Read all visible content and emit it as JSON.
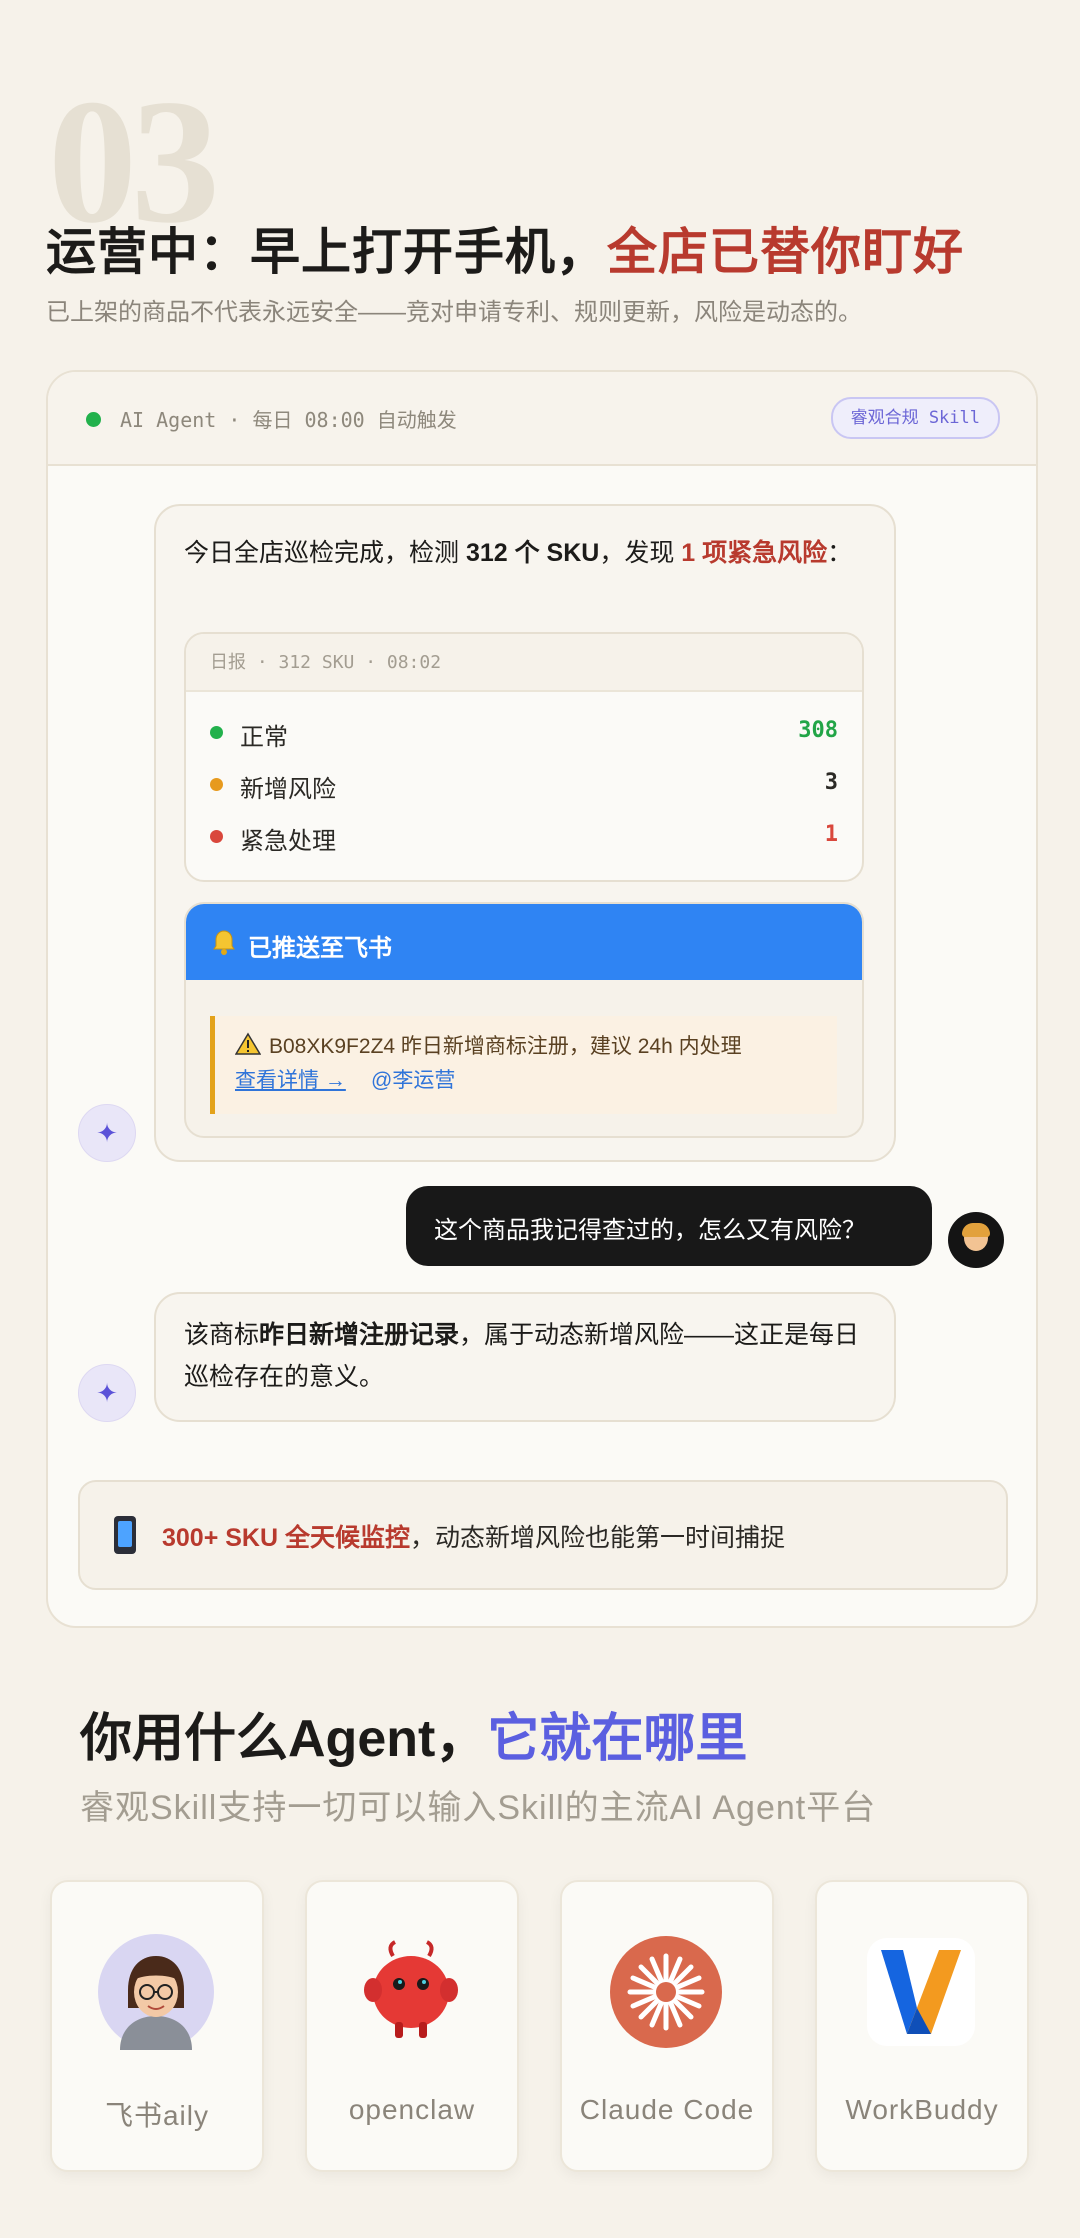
{
  "section_number": "03",
  "section1": {
    "title_part1": "运营中：早上打开手机，",
    "title_part2": "全店已替你盯好",
    "subtitle": "已上架的商品不代表永远安全——竞对申请专利、规则更新，风险是动态的。"
  },
  "chat_card": {
    "header": {
      "status_color": "#22b14c",
      "label": "AI Agent · 每日 08:00 自动触发",
      "skill_badge": "睿观合规 Skill"
    },
    "ai_message_1": {
      "text_prefix": "今日全店巡检完成，检测 ",
      "sku_count": "312 个 SKU",
      "text_middle": "，发现 ",
      "risk": "1 项紧急风险",
      "text_suffix": "："
    },
    "report": {
      "header": "日报 · 312 SKU · 08:02",
      "rows": [
        {
          "label": "正常",
          "value": "308",
          "color": "#22b14c"
        },
        {
          "label": "新增风险",
          "value": "3",
          "color": "#e79a1e"
        },
        {
          "label": "紧急处理",
          "value": "1",
          "color": "#d9473c"
        }
      ]
    },
    "feishu_card": {
      "title": "已推送至飞书",
      "alert": "B08XK9F2Z4 昨日新增商标注册，建议 24h 内处理",
      "link": "查看详情 →",
      "mention": "@李运营"
    },
    "user_message": "这个商品我记得查过的，怎么又有风险？",
    "ai_message_2": {
      "prefix": "该商标",
      "bold": "昨日新增注册记录",
      "suffix": "，属于动态新增风险——这正是每日巡检存在的意义。"
    },
    "monitor_banner": {
      "highlight": "300+ SKU 全天候监控",
      "text": "，动态新增风险也能第一时间捕捉"
    }
  },
  "section2": {
    "title_part1": "你用什么Agent，",
    "title_part2": "它就在哪里",
    "subtitle": "睿观Skill支持一切可以输入Skill的主流AI Agent平台"
  },
  "platforms": [
    {
      "name": "飞书aily",
      "icon": "aily-avatar-icon"
    },
    {
      "name": "openclaw",
      "icon": "red-monster-icon"
    },
    {
      "name": "Claude Code",
      "icon": "claude-asterisk-icon"
    },
    {
      "name": "WorkBuddy",
      "icon": "workbuddy-w-icon"
    }
  ]
}
